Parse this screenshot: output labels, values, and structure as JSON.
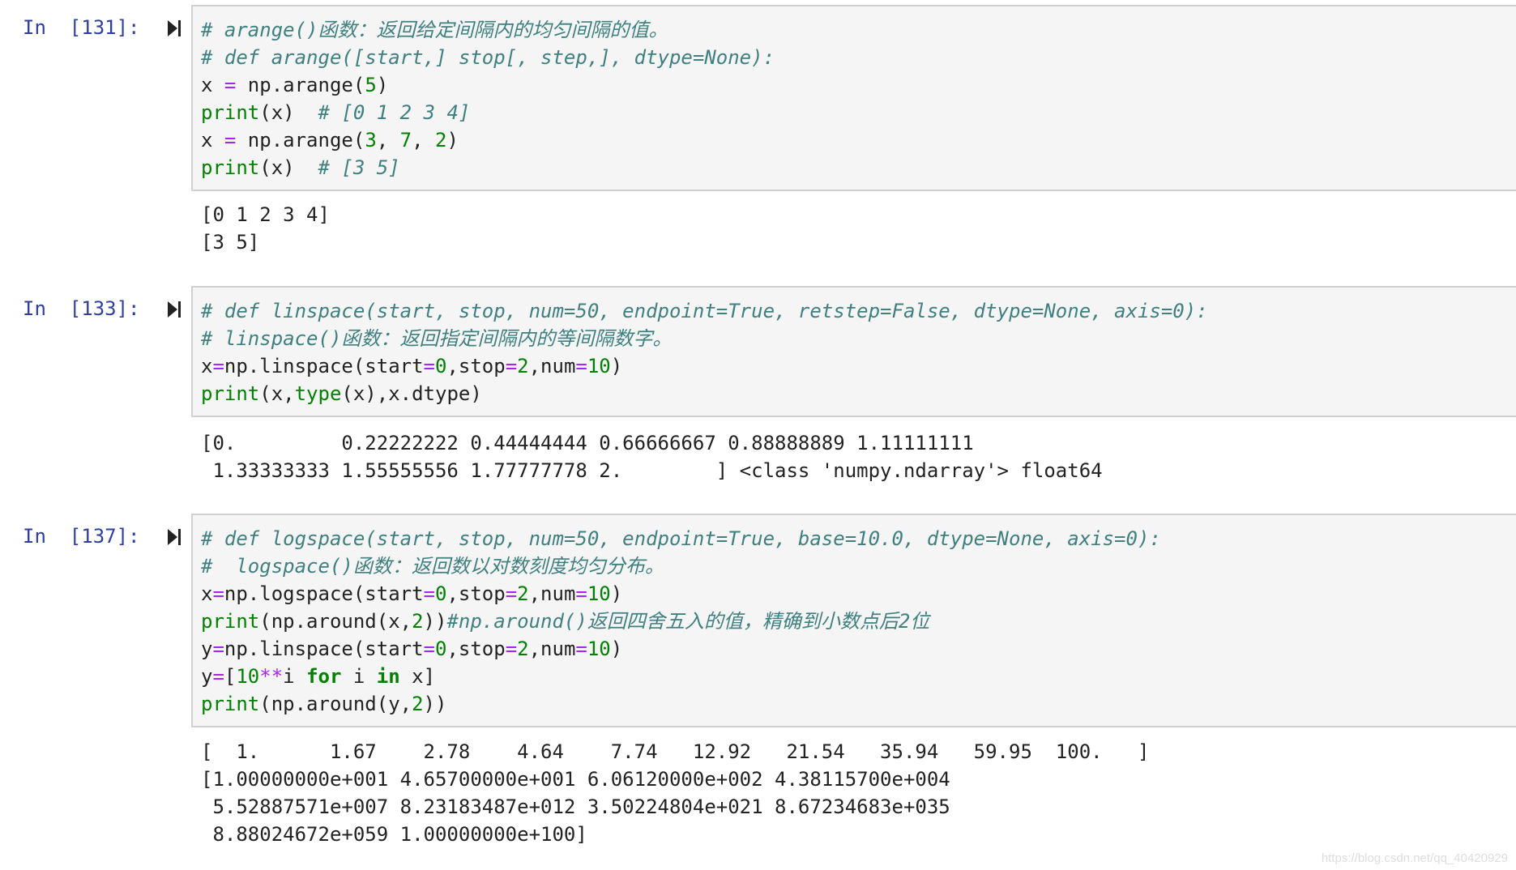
{
  "cells": [
    {
      "prompt": "In  [131]:",
      "code_lines": [
        [
          {
            "t": "# arange()函数：返回给定间隔内的均匀间隔的值。",
            "c": "cm"
          }
        ],
        [
          {
            "t": "# def arange([start,] stop[, step,], dtype=None):",
            "c": "cm"
          }
        ],
        [
          {
            "t": "x ",
            "c": "pl"
          },
          {
            "t": "=",
            "c": "op"
          },
          {
            "t": " np.arange(",
            "c": "pl"
          },
          {
            "t": "5",
            "c": "num"
          },
          {
            "t": ")",
            "c": "pl"
          }
        ],
        [
          {
            "t": "print",
            "c": "fn"
          },
          {
            "t": "(x)  ",
            "c": "pl"
          },
          {
            "t": "# [0 1 2 3 4]",
            "c": "cm"
          }
        ],
        [
          {
            "t": "x ",
            "c": "pl"
          },
          {
            "t": "=",
            "c": "op"
          },
          {
            "t": " np.arange(",
            "c": "pl"
          },
          {
            "t": "3",
            "c": "num"
          },
          {
            "t": ", ",
            "c": "pl"
          },
          {
            "t": "7",
            "c": "num"
          },
          {
            "t": ", ",
            "c": "pl"
          },
          {
            "t": "2",
            "c": "num"
          },
          {
            "t": ")",
            "c": "pl"
          }
        ],
        [
          {
            "t": "print",
            "c": "fn"
          },
          {
            "t": "(x)  ",
            "c": "pl"
          },
          {
            "t": "# [3 5]",
            "c": "cm"
          }
        ]
      ],
      "output_lines": [
        "[0 1 2 3 4]",
        "[3 5]"
      ]
    },
    {
      "prompt": "In  [133]:",
      "code_lines": [
        [
          {
            "t": "# def linspace(start, stop, num=50, endpoint=True, retstep=False, dtype=None, axis=0):",
            "c": "cm"
          }
        ],
        [
          {
            "t": "# linspace()函数：返回指定间隔内的等间隔数字。",
            "c": "cm"
          }
        ],
        [
          {
            "t": "x",
            "c": "pl"
          },
          {
            "t": "=",
            "c": "op"
          },
          {
            "t": "np.linspace(start",
            "c": "pl"
          },
          {
            "t": "=",
            "c": "op"
          },
          {
            "t": "0",
            "c": "num"
          },
          {
            "t": ",stop",
            "c": "pl"
          },
          {
            "t": "=",
            "c": "op"
          },
          {
            "t": "2",
            "c": "num"
          },
          {
            "t": ",num",
            "c": "pl"
          },
          {
            "t": "=",
            "c": "op"
          },
          {
            "t": "10",
            "c": "num"
          },
          {
            "t": ")",
            "c": "pl"
          }
        ],
        [
          {
            "t": "print",
            "c": "fn"
          },
          {
            "t": "(x,",
            "c": "pl"
          },
          {
            "t": "type",
            "c": "fn"
          },
          {
            "t": "(x),x.dtype)",
            "c": "pl"
          }
        ]
      ],
      "output_lines": [
        "[0.         0.22222222 0.44444444 0.66666667 0.88888889 1.11111111",
        " 1.33333333 1.55555556 1.77777778 2.        ] <class 'numpy.ndarray'> float64"
      ]
    },
    {
      "prompt": "In  [137]:",
      "code_lines": [
        [
          {
            "t": "# def logspace(start, stop, num=50, endpoint=True, base=10.0, dtype=None, axis=0):",
            "c": "cm"
          }
        ],
        [
          {
            "t": "#  logspace()函数：返回数以对数刻度均匀分布。",
            "c": "cm"
          }
        ],
        [
          {
            "t": "x",
            "c": "pl"
          },
          {
            "t": "=",
            "c": "op"
          },
          {
            "t": "np.logspace(start",
            "c": "pl"
          },
          {
            "t": "=",
            "c": "op"
          },
          {
            "t": "0",
            "c": "num"
          },
          {
            "t": ",stop",
            "c": "pl"
          },
          {
            "t": "=",
            "c": "op"
          },
          {
            "t": "2",
            "c": "num"
          },
          {
            "t": ",num",
            "c": "pl"
          },
          {
            "t": "=",
            "c": "op"
          },
          {
            "t": "10",
            "c": "num"
          },
          {
            "t": ")",
            "c": "pl"
          }
        ],
        [
          {
            "t": "print",
            "c": "fn"
          },
          {
            "t": "(np.around(x,",
            "c": "pl"
          },
          {
            "t": "2",
            "c": "num"
          },
          {
            "t": "))",
            "c": "pl"
          },
          {
            "t": "#np.around()返回四舍五入的值，精确到小数点后2位",
            "c": "cm"
          }
        ],
        [
          {
            "t": "y",
            "c": "pl"
          },
          {
            "t": "=",
            "c": "op"
          },
          {
            "t": "np.linspace(start",
            "c": "pl"
          },
          {
            "t": "=",
            "c": "op"
          },
          {
            "t": "0",
            "c": "num"
          },
          {
            "t": ",stop",
            "c": "pl"
          },
          {
            "t": "=",
            "c": "op"
          },
          {
            "t": "2",
            "c": "num"
          },
          {
            "t": ",num",
            "c": "pl"
          },
          {
            "t": "=",
            "c": "op"
          },
          {
            "t": "10",
            "c": "num"
          },
          {
            "t": ")",
            "c": "pl"
          }
        ],
        [
          {
            "t": "y",
            "c": "pl"
          },
          {
            "t": "=",
            "c": "op"
          },
          {
            "t": "[",
            "c": "pl"
          },
          {
            "t": "10",
            "c": "num"
          },
          {
            "t": "**",
            "c": "op"
          },
          {
            "t": "i ",
            "c": "pl"
          },
          {
            "t": "for",
            "c": "kw"
          },
          {
            "t": " i ",
            "c": "pl"
          },
          {
            "t": "in",
            "c": "kw"
          },
          {
            "t": " x]",
            "c": "pl"
          }
        ],
        [
          {
            "t": "print",
            "c": "fn"
          },
          {
            "t": "(np.around(y,",
            "c": "pl"
          },
          {
            "t": "2",
            "c": "num"
          },
          {
            "t": "))",
            "c": "pl"
          }
        ]
      ],
      "output_lines": [
        "[  1.      1.67    2.78    4.64    7.74   12.92   21.54   35.94   59.95  100.   ]",
        "[1.00000000e+001 4.65700000e+001 6.06120000e+002 4.38115700e+004",
        " 5.52887571e+007 8.23183487e+012 3.50224804e+021 8.67234683e+035",
        " 8.88024672e+059 1.00000000e+100]"
      ]
    }
  ],
  "watermark": "https://blog.csdn.net/qq_40420929"
}
